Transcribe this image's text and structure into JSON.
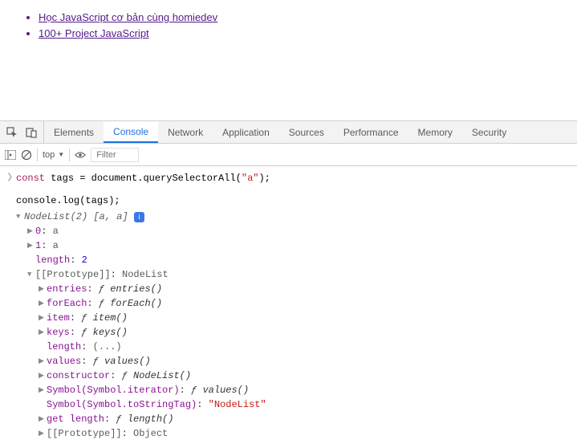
{
  "page": {
    "links": [
      "Học JavaScript cơ bản cùng homiedev",
      "100+ Project JavaScript"
    ]
  },
  "devtools": {
    "tabs": [
      "Elements",
      "Console",
      "Network",
      "Application",
      "Sources",
      "Performance",
      "Memory",
      "Security"
    ],
    "activeTab": "Console",
    "toolbar": {
      "context": "top",
      "filter_placeholder": "Filter"
    }
  },
  "console": {
    "input1": {
      "kw": "const",
      "var": "tags",
      "code": " = document.querySelectorAll(",
      "arg": "\"a\"",
      "end": ");"
    },
    "input2": "console.log(tags);",
    "output": {
      "header_italic": "NodeList(2) ",
      "header_bracket": "[a, a]",
      "item0_k": "0",
      "item0_v": "a",
      "item1_k": "1",
      "item1_v": "a",
      "length_k": "length",
      "length_v": "2",
      "proto_label": "[[Prototype]]",
      "proto_type": "NodeList",
      "entries_k": "entries",
      "entries_v": "entries()",
      "forEach_k": "forEach",
      "forEach_v": "forEach()",
      "item_k": "item",
      "item_v": "item()",
      "keys_k": "keys",
      "keys_v": "keys()",
      "len2_k": "length",
      "len2_v": "(...)",
      "values_k": "values",
      "values_v": "values()",
      "ctor_k": "constructor",
      "ctor_v": "NodeList()",
      "symIter_k": "Symbol(Symbol.iterator)",
      "symIter_v": "values()",
      "symTag_k": "Symbol(Symbol.toStringTag)",
      "symTag_v": "\"NodeList\"",
      "getlen_k": "get length",
      "getlen_v": "length()",
      "proto2_label": "[[Prototype]]",
      "proto2_type": "Object"
    }
  }
}
